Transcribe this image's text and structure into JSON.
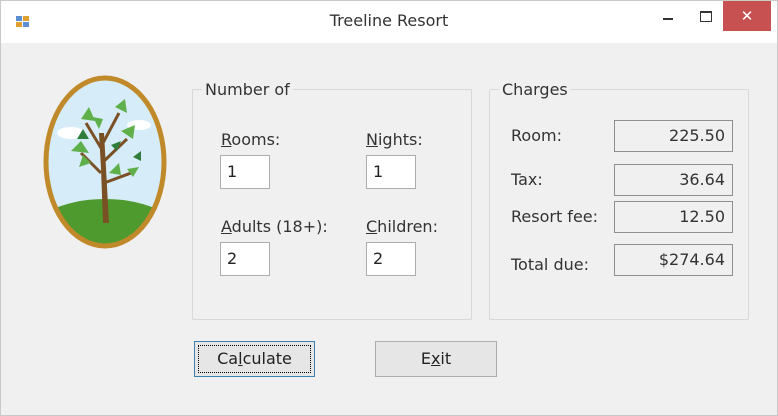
{
  "window": {
    "title": "Treeline Resort"
  },
  "titlebar_icons": {
    "app": "app-icon",
    "minimize": "minimize-icon",
    "maximize": "maximize-icon",
    "close": "close-icon"
  },
  "number_group": {
    "title": "Number of",
    "rooms_label_u": "R",
    "rooms_label_rest": "ooms:",
    "rooms_value": "1",
    "nights_label_u": "N",
    "nights_label_rest": "ights:",
    "nights_value": "1",
    "adults_label_u": "A",
    "adults_label_rest": "dults (18+):",
    "adults_value": "2",
    "children_label_u": "C",
    "children_label_rest": "hildren:",
    "children_value": "2"
  },
  "charges_group": {
    "title": "Charges",
    "room_label": "Room:",
    "room_value": "225.50",
    "tax_label": "Tax:",
    "tax_value": "36.64",
    "resort_fee_label": "Resort fee:",
    "resort_fee_value": "12.50",
    "total_label": "Total due:",
    "total_value": "$274.64"
  },
  "buttons": {
    "calculate_pre": "Ca",
    "calculate_u": "l",
    "calculate_post": "culate",
    "exit_pre": "E",
    "exit_u": "x",
    "exit_post": "it"
  },
  "colors": {
    "close_button": "#c75050",
    "form_background": "#f0f0f0",
    "focus_border": "#3c7fb1"
  }
}
